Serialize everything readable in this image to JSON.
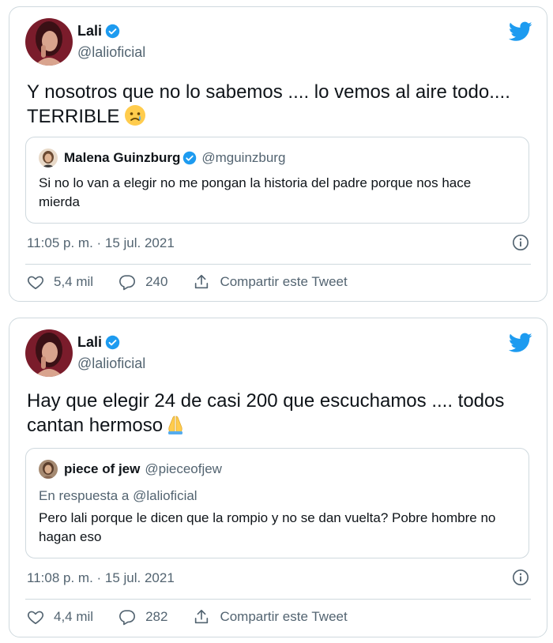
{
  "colors": {
    "twitter_blue": "#1d9bf0",
    "text": "#0f1419",
    "secondary": "#536471",
    "border": "#cfd9de"
  },
  "tweets": [
    {
      "author": {
        "name": "Lali",
        "handle": "@lalioficial",
        "verified": true
      },
      "text": "Y nosotros que no lo sabemos .... lo vemos al aire todo.... TERRIBLE",
      "emoji": "crying-face",
      "quote": {
        "name": "Malena Guinzburg",
        "verified": true,
        "handle": "@mguinzburg",
        "reply_to": "",
        "text": "Si no lo van a elegir no me pongan la historia del padre porque nos hace mierda"
      },
      "timestamp": "11:05 p. m. · 15 jul. 2021",
      "likes": "5,4 mil",
      "replies": "240",
      "share_label": "Compartir este Tweet"
    },
    {
      "author": {
        "name": "Lali",
        "handle": "@lalioficial",
        "verified": true
      },
      "text": "Hay que elegir 24 de casi 200 que escuchamos .... todos cantan hermoso",
      "emoji": "folded-hands",
      "quote": {
        "name": "piece of jew",
        "verified": false,
        "handle": "@pieceofjew",
        "reply_to": "En respuesta a @lalioficial",
        "text": "Pero lali porque le dicen que la rompio y no se dan vuelta? Pobre hombre no hagan eso"
      },
      "timestamp": "11:08 p. m. · 15 jul. 2021",
      "likes": "4,4 mil",
      "replies": "282",
      "share_label": "Compartir este Tweet"
    }
  ]
}
